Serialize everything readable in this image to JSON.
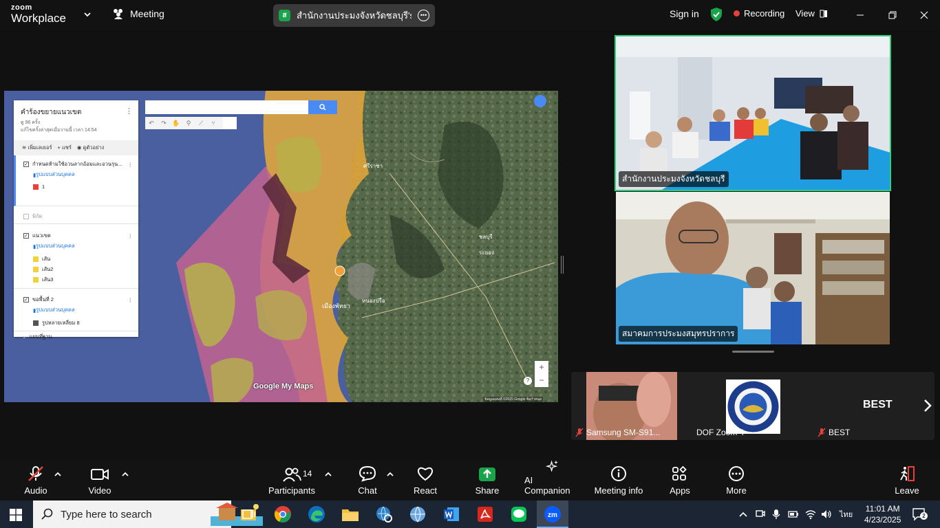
{
  "app": {
    "logo_line1": "zoom",
    "logo_line2": "Workplace",
    "meeting_tab": "Meeting",
    "share_badge": "ส",
    "share_title": "สำนักงานประมงจังหวัดชลบุรี's screen",
    "signin": "Sign in",
    "recording": "Recording",
    "view": "View",
    "accent_green": "#1aa34a",
    "recording_red": "#e8413c"
  },
  "mymaps": {
    "title": "คำร้องขยายแนวเขต",
    "views": "ดู 96 ครั้ง",
    "updated": "แก้ไขครั้งล่าสุดเมื่อวานนี้ เวลา 14:54",
    "actions": [
      "เพิ่มเลเยอร์",
      "แชร์",
      "ดูตัวอย่าง"
    ],
    "layer1_name": "กำหนดห้ามใช้อวนลากอ้อมและอวนรุน...",
    "layer1_style": "รูปแบบส่วนบุคคล",
    "layer1_item": "1",
    "layer2_name": "พิกัด",
    "layer3_name": "แนวเขต",
    "layer3_style": "รูปแบบส่วนบุคคล",
    "layer3_items": [
      "เส้น",
      "เส้น2",
      "เส้น3"
    ],
    "layer4_name": "ขอพื้นที่ 2",
    "layer4_style": "รูปแบบส่วนบุคคล",
    "layer4_item": "รูปหลายเหลี่ยม 8",
    "basemap": "แผนที่ฐาน",
    "branding": "Google My Maps",
    "attribution": "ข้อมูลแผนที่ ©2025 Google",
    "attribution_terms": "ข้อกำหนด",
    "zoom_in": "+",
    "zoom_out": "−",
    "help": "?",
    "place_labels": [
      "ชลบุรี",
      "ระยอง",
      "เมืองพัทยา",
      "หนองปรือ",
      "ศรีราชา"
    ],
    "colors": {
      "sea": "#4a5fa0",
      "orange_zone": "#e7a93a",
      "pink_zone": "#c2648f",
      "dark_zone": "#5c2a3c",
      "green_zone": "#b5b24a"
    }
  },
  "videos": {
    "top_label": "สำนักงานประมงจังหวัดชลบุรี",
    "bottom_label": "สมาคมการประมงสมุทรปราการ"
  },
  "strip": {
    "tiles": [
      {
        "name": "Samsung SM-S91...",
        "muted": true
      },
      {
        "name": "DOF Zoom 4",
        "muted": false
      },
      {
        "name": "BEST",
        "muted": true
      }
    ],
    "best_display": "BEST"
  },
  "toolbar": {
    "audio": "Audio",
    "video": "Video",
    "participants": "Participants",
    "participants_count": "14",
    "chat": "Chat",
    "react": "React",
    "share": "Share",
    "ai": "AI Companion",
    "info": "Meeting info",
    "apps": "Apps",
    "more": "More",
    "leave": "Leave"
  },
  "taskbar": {
    "search_placeholder": "Type here to search",
    "lang": "ไทย",
    "time": "11:01 AM",
    "date": "4/23/2025",
    "notifications": "2"
  }
}
